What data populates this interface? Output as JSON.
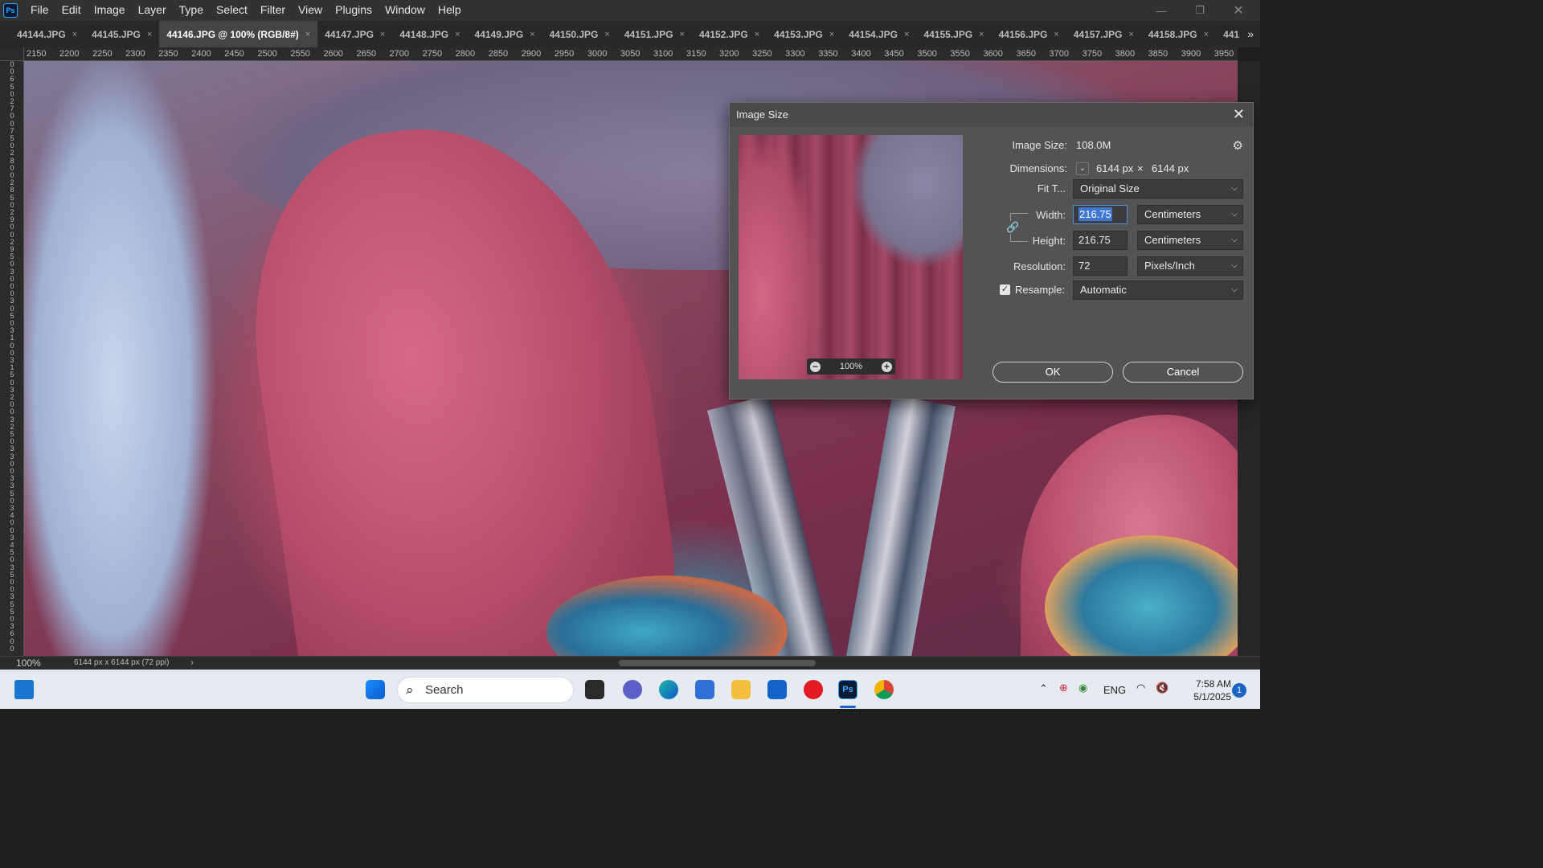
{
  "menubar": {
    "logo": "Ps",
    "items": [
      "File",
      "Edit",
      "Image",
      "Layer",
      "Type",
      "Select",
      "Filter",
      "View",
      "Plugins",
      "Window",
      "Help"
    ]
  },
  "tabs": [
    {
      "label": "44144.JPG",
      "active": false
    },
    {
      "label": "44145.JPG",
      "active": false
    },
    {
      "label": "44146.JPG @ 100% (RGB/8#)",
      "active": true
    },
    {
      "label": "44147.JPG",
      "active": false
    },
    {
      "label": "44148.JPG",
      "active": false
    },
    {
      "label": "44149.JPG",
      "active": false
    },
    {
      "label": "44150.JPG",
      "active": false
    },
    {
      "label": "44151.JPG",
      "active": false
    },
    {
      "label": "44152.JPG",
      "active": false
    },
    {
      "label": "44153.JPG",
      "active": false
    },
    {
      "label": "44154.JPG",
      "active": false
    },
    {
      "label": "44155.JPG",
      "active": false
    },
    {
      "label": "44156.JPG",
      "active": false
    },
    {
      "label": "44157.JPG",
      "active": false
    },
    {
      "label": "44158.JPG",
      "active": false
    },
    {
      "label": "441",
      "active": false
    }
  ],
  "tab_close_glyph": "×",
  "tab_overflow": "»",
  "ruler_h": [
    "2150",
    "2200",
    "2250",
    "2300",
    "2350",
    "2400",
    "2450",
    "2500",
    "2550",
    "2600",
    "2650",
    "2700",
    "2750",
    "2800",
    "2850",
    "2900",
    "2950",
    "3000",
    "3050",
    "3100",
    "3150",
    "3200",
    "3250",
    "3300",
    "3350",
    "3400",
    "3450",
    "3500",
    "3550",
    "3600",
    "3650",
    "3700",
    "3750",
    "3800",
    "3850",
    "3900",
    "3950"
  ],
  "ruler_v": [
    "0",
    "0",
    "6",
    "5",
    "0",
    "2",
    "7",
    "0",
    "0",
    "7",
    "5",
    "0",
    "2",
    "8",
    "0",
    "0",
    "2",
    "8",
    "5",
    "0",
    "2",
    "9",
    "0",
    "0",
    "2",
    "9",
    "5",
    "0",
    "3",
    "0",
    "0",
    "0",
    "3",
    "0",
    "5",
    "0",
    "3",
    "1",
    "0",
    "0",
    "3",
    "1",
    "5",
    "0",
    "3",
    "2",
    "0",
    "0",
    "3",
    "2",
    "5",
    "0",
    "3",
    "3",
    "0",
    "0",
    "3",
    "3",
    "5",
    "0",
    "3",
    "4",
    "0",
    "0",
    "3",
    "4",
    "5",
    "0",
    "3",
    "5",
    "0",
    "0",
    "3",
    "5",
    "5",
    "0",
    "3",
    "6",
    "0",
    "0"
  ],
  "dialog": {
    "title": "Image Size",
    "close_glyph": "✕",
    "image_size_label": "Image Size:",
    "image_size_value": "108.0M",
    "dimensions_label": "Dimensions:",
    "dim_width": "6144 px",
    "dim_times": "×",
    "dim_height": "6144 px",
    "fit_label": "Fit T...",
    "fit_value": "Original Size",
    "width_label": "Width:",
    "width_value": "216.75",
    "width_unit": "Centimeters",
    "height_label": "Height:",
    "height_value": "216.75",
    "height_unit": "Centimeters",
    "resolution_label": "Resolution:",
    "resolution_value": "72",
    "resolution_unit": "Pixels/Inch",
    "resample_label": "Resample:",
    "resample_checked": true,
    "resample_value": "Automatic",
    "preview_zoom": "100%",
    "ok_label": "OK",
    "cancel_label": "Cancel"
  },
  "status": {
    "zoom": "100%",
    "doc_info": "6144 px x 6144 px (72 ppi)",
    "arrow": "›"
  },
  "taskbar": {
    "search_placeholder": "Search",
    "language": "ENG",
    "time": "7:58 AM",
    "date": "5/1/2025",
    "notification_count": "1"
  },
  "colors": {
    "ps_blue": "#31a8ff",
    "focus_blue": "#3f76d4",
    "dialog_bg": "#535353",
    "taskbar_bg": "#e6ebf1"
  }
}
